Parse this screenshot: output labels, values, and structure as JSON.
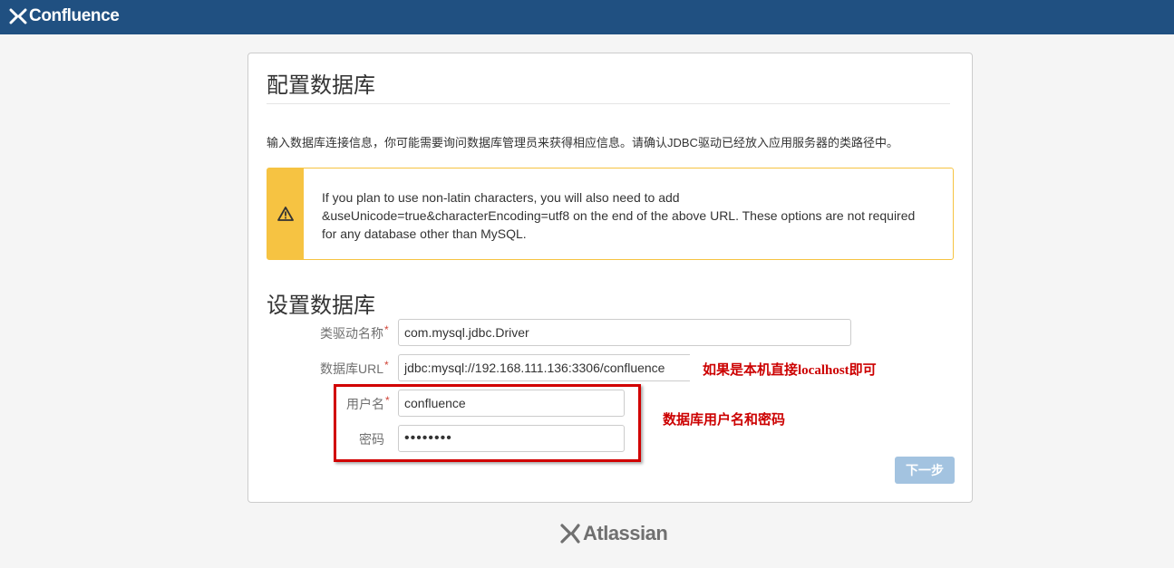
{
  "header": {
    "app_name": "Confluence",
    "logo_icon": "confluence-x-icon",
    "bg_color": "#205081"
  },
  "page": {
    "title": "配置数据库",
    "intro": "输入数据库连接信息，你可能需要询问数据库管理员来获得相应信息。请确认JDBC驱动已经放入应用服务器的类路径中。"
  },
  "warning": {
    "icon": "warning-icon",
    "color": "#f6c342",
    "line1": "If you plan to use non-latin characters, you will also need to add",
    "line2": "&useUnicode=true&characterEncoding=utf8 on the end of the above URL. These options are not required",
    "line3": "for any database other than MySQL."
  },
  "form": {
    "section_title": "设置数据库",
    "required_mark": "*",
    "driver_label": "类驱动名称",
    "driver_value": "com.mysql.jdbc.Driver",
    "url_label": "数据库URL",
    "url_value": "jdbc:mysql://192.168.111.136:3306/confluence",
    "username_label": "用户名",
    "username_value": "confluence",
    "password_label": "密码",
    "password_mask": "••••••••",
    "next_button": "下一步",
    "next_button_color": "#a3c3e0"
  },
  "annotations": {
    "url_note": "如果是本机直接localhost即可",
    "credentials_note": "数据库用户名和密码",
    "color": "#cc0000"
  },
  "footer": {
    "brand": "Atlassian",
    "icon": "atlassian-icon"
  }
}
